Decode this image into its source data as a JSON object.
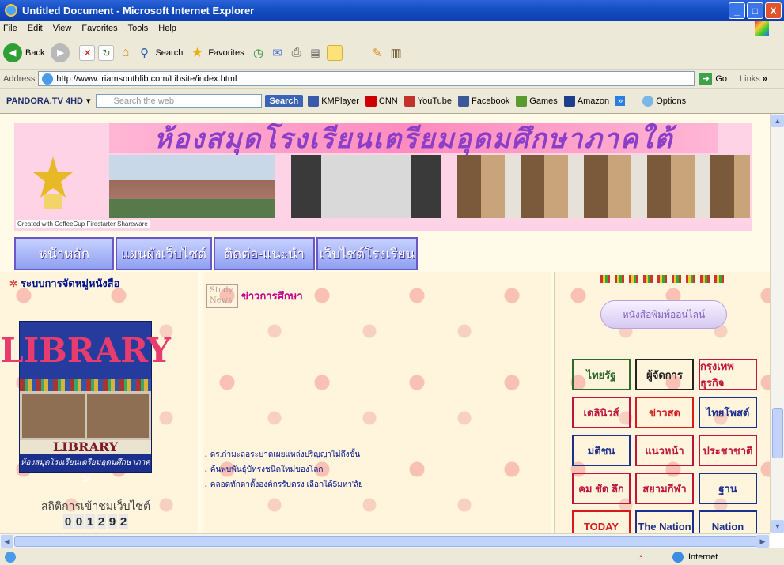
{
  "window": {
    "title": "Untitled Document - Microsoft Internet Explorer",
    "minimize": "_",
    "maximize": "□",
    "close": "X"
  },
  "menu": [
    "File",
    "Edit",
    "View",
    "Favorites",
    "Tools",
    "Help"
  ],
  "toolbar": {
    "back": "Back",
    "search": "Search",
    "favorites": "Favorites"
  },
  "address": {
    "label": "Address",
    "url": "http://www.triamsouthlib.com/Libsite/index.html",
    "go": "Go",
    "links": "Links"
  },
  "linksbar": {
    "pandora": "PANDORA.TV 4HD",
    "search_placeholder": "Search the web",
    "search_button": "Search",
    "items": [
      "KMPlayer",
      "CNN",
      "YouTube",
      "Facebook",
      "Games",
      "Amazon"
    ],
    "options": "Options"
  },
  "banner": {
    "title": "ห้องสมุดโรงเรียนเตรียมอุดมศึกษาภาคใต้",
    "credit": "Created with CoffeeCup Firestarter Shareware"
  },
  "nav": [
    "หน้าหลัก",
    "แผนผังเว็บไซต์",
    "ติดต่อ-แนะนำ",
    "เว็บไซต์โรงเรียน"
  ],
  "left": {
    "category_link": "ระบบการจัดหมู่หนังสือ",
    "library_banner_word": "LIBRARY",
    "library_top_word": "LIBRARY",
    "library_caption": "ห้องสมุดโรงเรียนเตรียมอุดมศึกษาภาคใต้",
    "stats_label": "สถิติการเข้าชมเว็บไซต์",
    "counter": [
      "0",
      "0",
      "1",
      "2",
      "9",
      "2"
    ]
  },
  "middle": {
    "study_news_label": "Study News",
    "news_title": "ข่าวการศึกษา",
    "news_items": [
      "ดร.ก่ามะลอระบาดเผยแหล่งปริญญาไม่ถึงขั้น",
      "ค้นพบพันธุ์บัทรงชนิดใหม่ของโลก",
      "คลอดทักตาตั้งองค์กรรับตรง เลือกได้5มหา'ลัย"
    ]
  },
  "right": {
    "online_label": "หนังสือพิมพ์ออนไลน์",
    "papers": [
      "ไทยรัฐ",
      "ผู้จัดการ",
      "กรุงเทพธุรกิจ",
      "เดลินิวส์",
      "ข่าวสด",
      "ไทยโพสต์",
      "มติชน",
      "แนวหน้า",
      "ประชาชาติ",
      "คม ชัด ลึก",
      "สยามกีฬา",
      "ฐาน",
      "TODAY",
      "The Nation",
      "Nation"
    ],
    "paper_colors": [
      "#2d6a2d",
      "#222222",
      "#c0143c",
      "#c0143c",
      "#d41a1a",
      "#1b2f8c",
      "#1b2f8c",
      "#c0143c",
      "#c0143c",
      "#c0143c",
      "#c0143c",
      "#1b2f8c",
      "#d41a1a",
      "#1b2f8c",
      "#1b2f8c"
    ]
  },
  "status": {
    "zone": "Internet"
  }
}
